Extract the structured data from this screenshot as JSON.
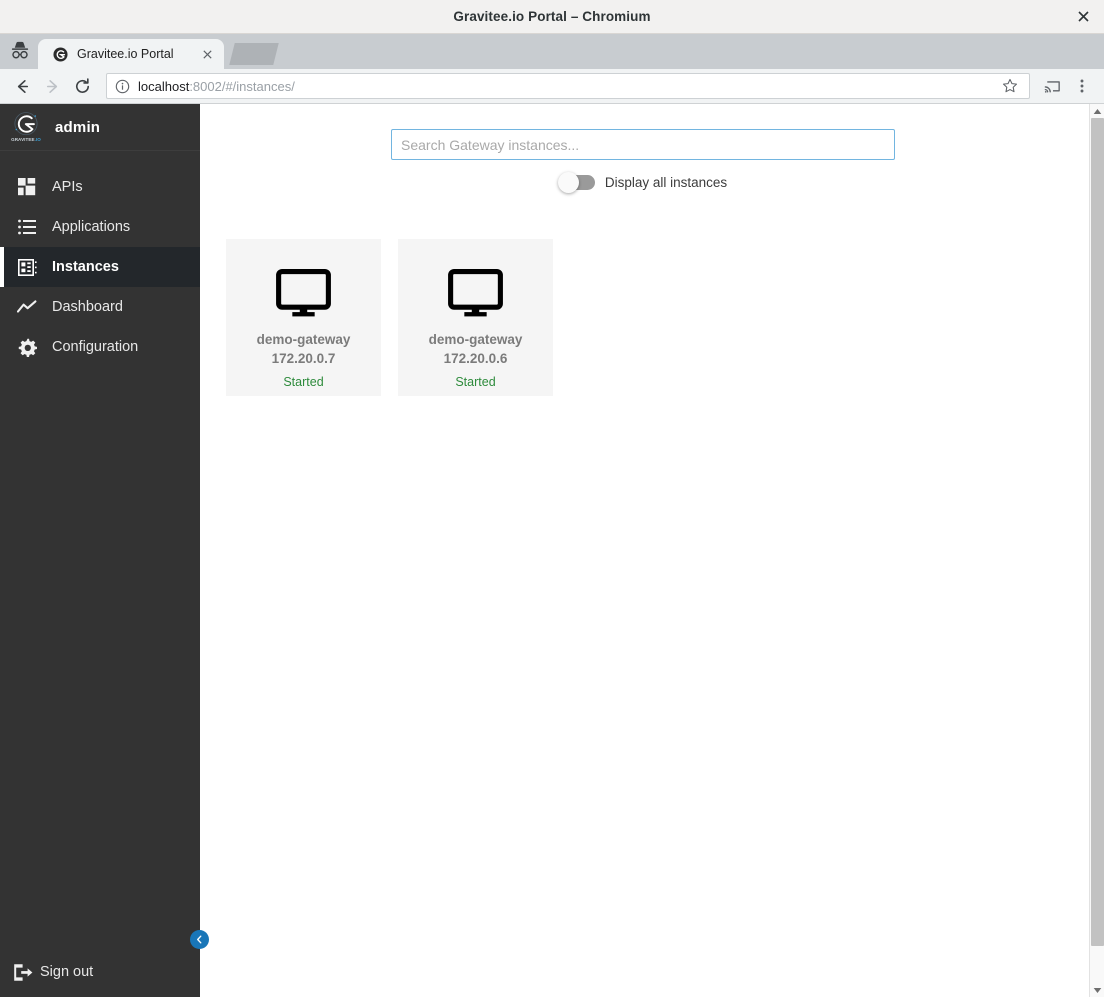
{
  "window": {
    "title": "Gravitee.io Portal – Chromium",
    "close_label": "✕"
  },
  "browser": {
    "incognito_icon": "incognito-hat-icon",
    "tab": {
      "title": "Gravitee.io Portal",
      "favicon": "gravitee-favicon",
      "close_label": "✕"
    },
    "toolbar": {
      "back_icon": "back-arrow-icon",
      "forward_icon": "forward-arrow-icon",
      "reload_icon": "reload-icon",
      "info_icon": "page-info-icon",
      "url_host": "localhost",
      "url_rest": ":8002/#/instances/",
      "url_full": "localhost:8002/#/instances/",
      "star_icon": "bookmark-star-icon",
      "cast_icon": "cast-icon",
      "menu_icon": "three-dot-menu-icon"
    }
  },
  "sidebar": {
    "logo_icon": "gravitee-logo-icon",
    "logo_wordmark": "GRAVITEE.IO",
    "user": "admin",
    "items": [
      {
        "label": "APIs",
        "icon": "grid-squares-icon",
        "active": false
      },
      {
        "label": "Applications",
        "icon": "list-icon",
        "active": false
      },
      {
        "label": "Instances",
        "icon": "instances-panel-icon",
        "active": true
      },
      {
        "label": "Dashboard",
        "icon": "trending-line-icon",
        "active": false
      },
      {
        "label": "Configuration",
        "icon": "gear-icon",
        "active": false
      }
    ],
    "signout": {
      "label": "Sign out",
      "icon": "logout-icon"
    },
    "collapse": {
      "icon": "chevron-left-icon"
    }
  },
  "main": {
    "search": {
      "placeholder": "Search Gateway instances...",
      "value": ""
    },
    "toggle": {
      "label": "Display all instances",
      "checked": false
    },
    "instances": [
      {
        "name": "demo-gateway",
        "ip": "172.20.0.7",
        "status": "Started",
        "icon": "monitor-icon"
      },
      {
        "name": "demo-gateway",
        "ip": "172.20.0.6",
        "status": "Started",
        "icon": "monitor-icon"
      }
    ]
  },
  "colors": {
    "sidebar_bg": "#333333",
    "sidebar_active_bg": "#23272b",
    "accent_blue": "#1976b8",
    "search_border": "#72b5e0",
    "status_green": "#2e8b3c",
    "card_bg": "#f5f5f5"
  },
  "scrollbar": {
    "up_icon": "scroll-up-arrow-icon",
    "down_icon": "scroll-down-arrow-icon"
  }
}
